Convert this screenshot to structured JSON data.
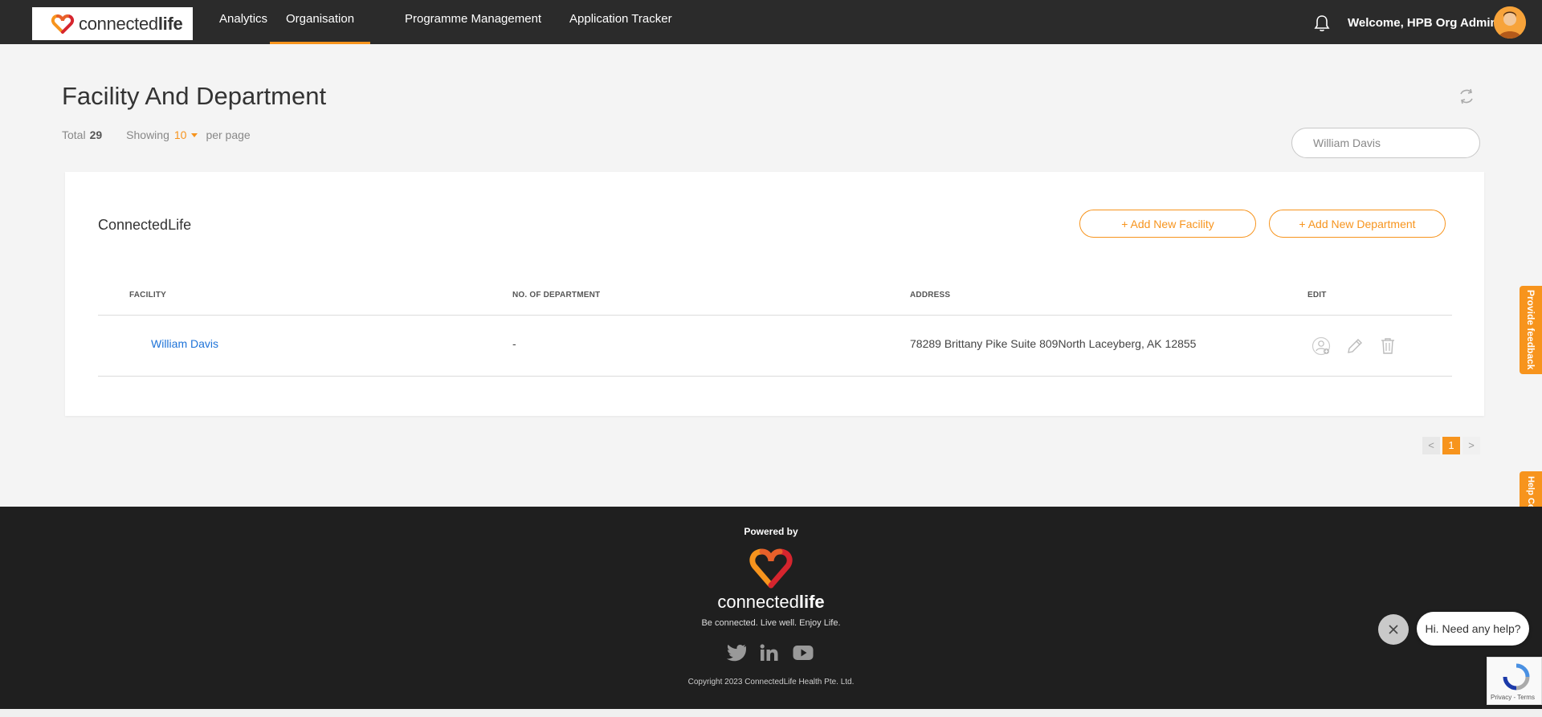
{
  "header": {
    "logo_text_light": "connected",
    "logo_text_bold": "life",
    "nav": [
      {
        "label": "Analytics"
      },
      {
        "label": "Organisation"
      },
      {
        "label": "Programme Management"
      },
      {
        "label": "Application Tracker"
      }
    ],
    "active_nav": "Organisation",
    "welcome": "Welcome, HPB Org Admin"
  },
  "page": {
    "title": "Facility And Department",
    "total_label": "Total",
    "total_value": "29",
    "showing_label": "Showing",
    "per_page_value": "10",
    "per_page_label": "per page",
    "search_value": "William Davis"
  },
  "card": {
    "org_name": "ConnectedLife",
    "add_facility_label": "+ Add New Facility",
    "add_department_label": "+ Add New Department",
    "columns": [
      "FACILITY",
      "NO. OF DEPARTMENT",
      "ADDRESS",
      "EDIT"
    ],
    "rows": [
      {
        "facility": "William Davis",
        "departments": "-",
        "address": "78289 Brittany Pike Suite 809North Laceyberg, AK 12855"
      }
    ]
  },
  "pagination": {
    "prev": "<",
    "current": "1",
    "next": ">"
  },
  "side_tabs": {
    "feedback": "Provide feedback",
    "help": "Help Center"
  },
  "footer": {
    "powered_by": "Powered by",
    "brand_light": "connected",
    "brand_bold": "life",
    "tagline": "Be connected. Live well. Enjoy Life.",
    "social": [
      "twitter-icon",
      "linkedin-icon",
      "youtube-icon"
    ],
    "copyright": "Copyright 2023 ConnectedLife Health Pte. Ltd."
  },
  "chat": {
    "bubble": "Hi. Need any help?"
  },
  "recaptcha": {
    "links": "Privacy - Terms"
  },
  "colors": {
    "accent": "#f7941d",
    "topbar": "#2b2b2b",
    "footer": "#1f1f1f",
    "link": "#1e73d8"
  }
}
